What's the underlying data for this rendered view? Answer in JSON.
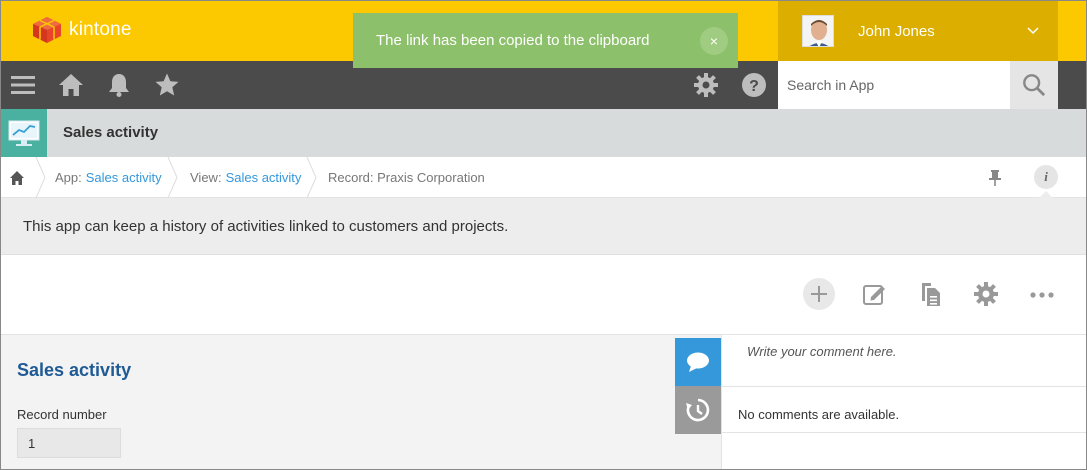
{
  "brand": {
    "name": "kintone"
  },
  "user": {
    "name": "John Jones"
  },
  "toast": {
    "message": "The link has been copied to the clipboard",
    "close": "×"
  },
  "search": {
    "placeholder": "Search in App"
  },
  "app": {
    "title": "Sales activity",
    "description": "This app can keep a history of activities linked to customers and projects."
  },
  "breadcrumb": {
    "app_label": "App:",
    "app_link": "Sales activity",
    "view_label": "View:",
    "view_link": "Sales activity",
    "record_label": "Record: Praxis Corporation"
  },
  "info_label": "i",
  "form": {
    "section_title": "Sales activity",
    "record_number_label": "Record number",
    "record_number_value": "1"
  },
  "comments": {
    "placeholder": "Write your comment here.",
    "empty_text": "No comments are available."
  },
  "colors": {
    "topbar": "#fcc800",
    "userbox": "#dcae00",
    "toast": "#8dc06b",
    "navbar": "#4b4b4b",
    "link": "#3498db",
    "section_title": "#1f5a95"
  },
  "icons": [
    "menu-icon",
    "home-icon",
    "bell-icon",
    "star-icon",
    "gear-icon",
    "help-icon",
    "search-icon",
    "pin-icon",
    "info-icon",
    "add-icon",
    "edit-icon",
    "duplicate-icon",
    "settings-icon",
    "more-icon",
    "comment-icon",
    "history-icon"
  ]
}
